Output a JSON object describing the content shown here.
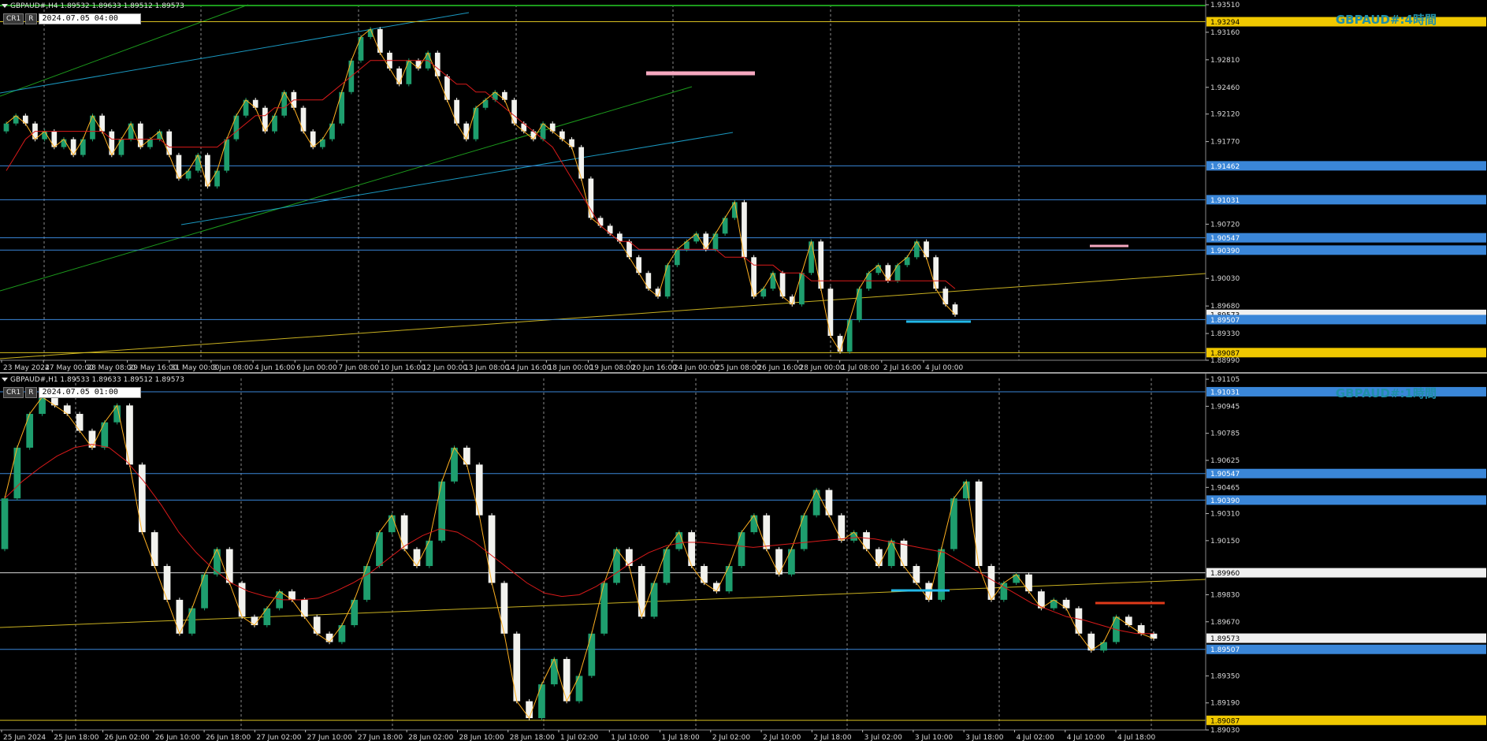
{
  "colors": {
    "background": "#000000",
    "bull_candle": "#1e9e6e",
    "bear_candle": "#f2f2ee",
    "ma_red": "#d91a1a",
    "zigzag_orange": "#ffb020",
    "trend_yellow": "#c8b020",
    "h_blue": "#3a86d8",
    "h_yellow": "#d8c020",
    "h_white": "#d8d8d8",
    "grid": "#b8b8b8",
    "channel_green": "#1c9a1c",
    "channel_cyan": "#1a98c0",
    "pink": "#f5a8c0",
    "cyan_mark": "#22b8e8",
    "red_mark": "#e03a1a"
  },
  "top": {
    "header_text": "GBPAUD#,H4  1.89532 1.89633 1.89512 1.89573",
    "cr_button": "CR1",
    "r_button": "R",
    "datetime": "2024.07.05 04:00",
    "timeframe_label": "GBPAUD#:4時間",
    "x_labels": [
      "23 May 2024",
      "27 May 00:00",
      "28 May 08:00",
      "29 May 16:00",
      "31 May 00:00",
      "3 Jun 08:00",
      "4 Jun 16:00",
      "6 Jun 00:00",
      "7 Jun 08:00",
      "10 Jun 16:00",
      "12 Jun 00:00",
      "13 Jun 08:00",
      "14 Jun 16:00",
      "18 Jun 00:00",
      "19 Jun 08:00",
      "20 Jun 16:00",
      "24 Jun 00:00",
      "25 Jun 08:00",
      "26 Jun 16:00",
      "28 Jun 00:00",
      "1 Jul 08:00",
      "2 Jul 16:00",
      "4 Jul 00:00"
    ],
    "y_ticks": [
      "1.93510",
      "1.93160",
      "1.92810",
      "1.92460",
      "1.92120",
      "1.91770",
      "1.90720",
      "1.90030",
      "1.89680",
      "1.89330",
      "1.88990"
    ],
    "price_labels": [
      {
        "text": "1.93294",
        "kind": "yellow"
      },
      {
        "text": "1.91462",
        "kind": "blue"
      },
      {
        "text": "1.91031",
        "kind": "blue"
      },
      {
        "text": "1.90547",
        "kind": "blue"
      },
      {
        "text": "1.90390",
        "kind": "blue"
      },
      {
        "text": "1.89573",
        "kind": "white"
      },
      {
        "text": "1.89507",
        "kind": "blue"
      },
      {
        "text": "1.89087",
        "kind": "yellow"
      }
    ]
  },
  "bottom": {
    "header_text": "GBPAUD#,H1  1.89533 1.89633 1.89512 1.89573",
    "cr_button": "CR1",
    "r_button": "R",
    "datetime": "2024.07.05 01:00",
    "timeframe_label": "GBPAUD#:1時間",
    "x_labels": [
      "25 Jun 2024",
      "25 Jun 18:00",
      "26 Jun 02:00",
      "26 Jun 10:00",
      "26 Jun 18:00",
      "27 Jun 02:00",
      "27 Jun 10:00",
      "27 Jun 18:00",
      "28 Jun 02:00",
      "28 Jun 10:00",
      "28 Jun 18:00",
      "1 Jul 02:00",
      "1 Jul 10:00",
      "1 Jul 18:00",
      "2 Jul 02:00",
      "2 Jul 10:00",
      "2 Jul 18:00",
      "3 Jul 02:00",
      "3 Jul 10:00",
      "3 Jul 18:00",
      "4 Jul 02:00",
      "4 Jul 10:00",
      "4 Jul 18:00"
    ],
    "y_ticks": [
      "1.91105",
      "1.90945",
      "1.90785",
      "1.90625",
      "1.90465",
      "1.90310",
      "1.90150",
      "1.89830",
      "1.89670",
      "1.89350",
      "1.89190",
      "1.89030"
    ],
    "price_labels": [
      {
        "text": "1.91031",
        "kind": "blue"
      },
      {
        "text": "1.90547",
        "kind": "blue"
      },
      {
        "text": "1.90390",
        "kind": "blue"
      },
      {
        "text": "1.89960",
        "kind": "white"
      },
      {
        "text": "1.89573",
        "kind": "white"
      },
      {
        "text": "1.89507",
        "kind": "blue"
      },
      {
        "text": "1.89087",
        "kind": "yellow"
      }
    ]
  },
  "chart_data": [
    {
      "type": "candlestick",
      "title": "GBPAUD#:4時間",
      "symbol": "GBPAUD#",
      "timeframe": "H4",
      "ylim": [
        1.8899,
        1.9351
      ],
      "close_series": [
        1.92,
        1.921,
        1.92,
        1.918,
        1.919,
        1.917,
        1.918,
        1.916,
        1.918,
        1.921,
        1.919,
        1.916,
        1.918,
        1.92,
        1.917,
        1.918,
        1.919,
        1.916,
        1.913,
        1.914,
        1.916,
        1.912,
        1.914,
        1.918,
        1.921,
        1.923,
        1.922,
        1.919,
        1.921,
        1.924,
        1.922,
        1.919,
        1.917,
        1.918,
        1.92,
        1.924,
        1.928,
        1.931,
        1.932,
        1.929,
        1.927,
        1.925,
        1.928,
        1.927,
        1.929,
        1.926,
        1.923,
        1.92,
        1.918,
        1.922,
        1.923,
        1.924,
        1.923,
        1.92,
        1.919,
        1.918,
        1.92,
        1.919,
        1.918,
        1.917,
        1.913,
        1.908,
        1.907,
        1.906,
        1.905,
        1.903,
        1.901,
        1.899,
        1.898,
        1.902,
        1.904,
        1.905,
        1.906,
        1.904,
        1.906,
        1.908,
        1.91,
        1.903,
        1.898,
        1.899,
        1.901,
        1.898,
        1.897,
        1.901,
        1.905,
        1.899,
        1.893,
        1.891,
        1.895,
        1.899,
        1.901,
        1.902,
        1.9,
        1.902,
        1.903,
        1.905,
        1.903,
        1.899,
        1.897,
        1.8957
      ],
      "ma_series": [
        1.914,
        1.916,
        1.918,
        1.919,
        1.919,
        1.919,
        1.919,
        1.919,
        1.919,
        1.919,
        1.919,
        1.918,
        1.918,
        1.918,
        1.918,
        1.918,
        1.918,
        1.917,
        1.917,
        1.917,
        1.917,
        1.917,
        1.917,
        1.918,
        1.919,
        1.92,
        1.921,
        1.921,
        1.922,
        1.922,
        1.923,
        1.923,
        1.923,
        1.923,
        1.924,
        1.925,
        1.926,
        1.927,
        1.928,
        1.928,
        1.928,
        1.928,
        1.928,
        1.928,
        1.928,
        1.927,
        1.926,
        1.925,
        1.925,
        1.924,
        1.924,
        1.923,
        1.922,
        1.921,
        1.92,
        1.919,
        1.918,
        1.917,
        1.915,
        1.913,
        1.911,
        1.909,
        1.907,
        1.906,
        1.905,
        1.905,
        1.904,
        1.904,
        1.904,
        1.904,
        1.904,
        1.904,
        1.904,
        1.904,
        1.904,
        1.903,
        1.903,
        1.903,
        1.902,
        1.902,
        1.902,
        1.901,
        1.901,
        1.901,
        1.9,
        1.9,
        1.9,
        1.9,
        1.9,
        1.9,
        1.9,
        1.9,
        1.9,
        1.9,
        1.9,
        1.9,
        1.9,
        1.9,
        1.9,
        1.899
      ],
      "horizontal_levels": [
        1.93294,
        1.91462,
        1.91031,
        1.90547,
        1.9039,
        1.89507,
        1.89087
      ],
      "last_price": 1.89573
    },
    {
      "type": "candlestick",
      "title": "GBPAUD#:1時間",
      "symbol": "GBPAUD#",
      "timeframe": "H1",
      "ylim": [
        1.8903,
        1.9111
      ],
      "close_series": [
        1.904,
        1.907,
        1.909,
        1.91,
        1.9095,
        1.909,
        1.908,
        1.907,
        1.9085,
        1.9095,
        1.906,
        1.902,
        1.9,
        1.898,
        1.896,
        1.8975,
        1.8995,
        1.901,
        1.899,
        1.897,
        1.8965,
        1.8975,
        1.8985,
        1.898,
        1.897,
        1.896,
        1.8955,
        1.8965,
        1.898,
        1.9,
        1.902,
        1.903,
        1.901,
        1.9,
        1.9015,
        1.905,
        1.907,
        1.906,
        1.903,
        1.899,
        1.896,
        1.892,
        1.891,
        1.893,
        1.8945,
        1.892,
        1.8935,
        1.896,
        1.899,
        1.901,
        1.9,
        1.897,
        1.899,
        1.901,
        1.902,
        1.9,
        1.899,
        1.8985,
        1.9,
        1.902,
        1.903,
        1.901,
        1.8995,
        1.901,
        1.903,
        1.9045,
        1.903,
        1.9015,
        1.902,
        1.901,
        1.9,
        1.9015,
        1.9,
        1.899,
        1.898,
        1.901,
        1.904,
        1.905,
        1.9,
        1.898,
        1.899,
        1.8995,
        1.8985,
        1.8975,
        1.898,
        1.8975,
        1.896,
        1.895,
        1.8955,
        1.897,
        1.8965,
        1.896,
        1.8957
      ],
      "ma_series": [
        1.904,
        1.905,
        1.9058,
        1.9065,
        1.907,
        1.9072,
        1.907,
        1.9062,
        1.905,
        1.9036,
        1.902,
        1.9008,
        1.8998,
        1.899,
        1.8985,
        1.8982,
        1.898,
        1.898,
        1.8981,
        1.8985,
        1.899,
        1.8996,
        1.9004,
        1.9012,
        1.9018,
        1.9022,
        1.902,
        1.9014,
        1.9006,
        1.8998,
        1.899,
        1.8984,
        1.8982,
        1.8983,
        1.8988,
        1.8995,
        1.9002,
        1.9008,
        1.9012,
        1.9014,
        1.9014,
        1.9013,
        1.9012,
        1.9011,
        1.9012,
        1.9013,
        1.9014,
        1.9015,
        1.9016,
        1.9017,
        1.9016,
        1.9014,
        1.9012,
        1.901,
        1.9008,
        1.9002,
        1.8996,
        1.899,
        1.8984,
        1.8978,
        1.8974,
        1.897,
        1.8968,
        1.8965,
        1.8962,
        1.896,
        1.896
      ],
      "horizontal_levels": [
        1.91031,
        1.90547,
        1.9039,
        1.8996,
        1.89507,
        1.89087
      ],
      "last_price": 1.89573
    }
  ]
}
